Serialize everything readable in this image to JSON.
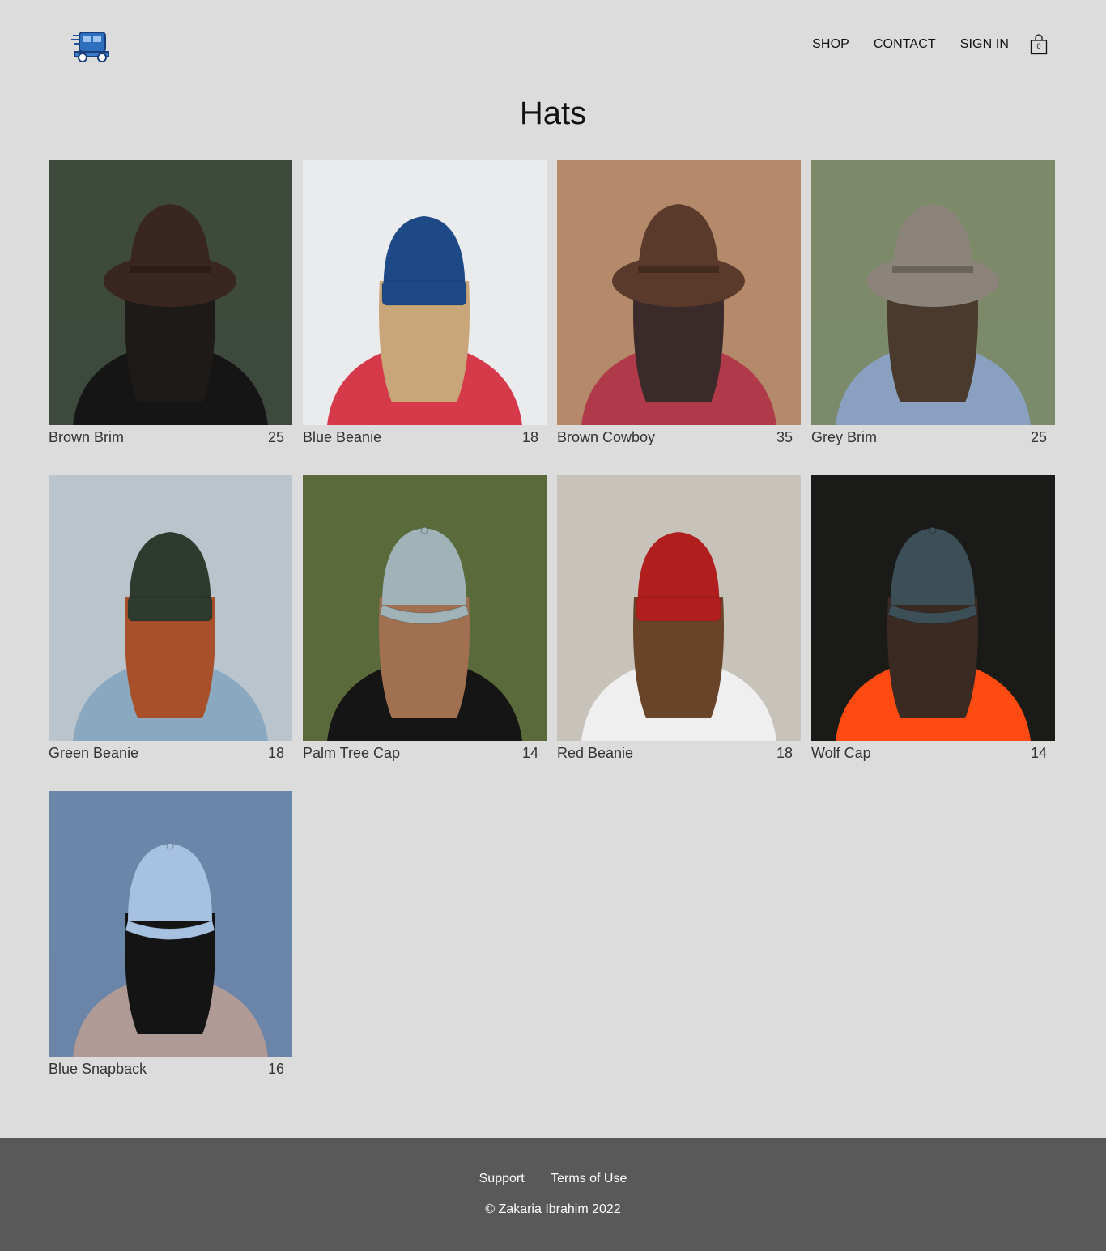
{
  "header": {
    "nav": [
      "SHOP",
      "CONTACT",
      "SIGN IN"
    ],
    "cart_count": "0"
  },
  "page_title": "Hats",
  "products": [
    {
      "name": "Brown Brim",
      "price": "25",
      "bg": "#3e4a3c",
      "hat": "#3a2620",
      "hair": "#1e1a18",
      "top": "#151515",
      "hatType": "brim"
    },
    {
      "name": "Blue Beanie",
      "price": "18",
      "bg": "#e9ebec",
      "hat": "#1d4a86",
      "hair": "#c9a67a",
      "top": "#d63a4a",
      "hatType": "beanie"
    },
    {
      "name": "Brown Cowboy",
      "price": "35",
      "bg": "#b58a6a",
      "hat": "#5a3a2a",
      "hair": "#3a2a2a",
      "top": "#b03a4a",
      "hatType": "brim"
    },
    {
      "name": "Grey Brim",
      "price": "25",
      "bg": "#7c8a6a",
      "hat": "#8c847a",
      "hair": "#4a3a2e",
      "top": "#8aa0c0",
      "hatType": "brim"
    },
    {
      "name": "Green Beanie",
      "price": "18",
      "bg": "#b9c4cc",
      "hat": "#2e3a2e",
      "hair": "#a8502a",
      "top": "#8aa8c0",
      "hatType": "beanie"
    },
    {
      "name": "Palm Tree Cap",
      "price": "14",
      "bg": "#5a6a3a",
      "hat": "#9fb3b8",
      "hair": "#a07050",
      "top": "#151515",
      "hatType": "cap"
    },
    {
      "name": "Red Beanie",
      "price": "18",
      "bg": "#c7c2ba",
      "hat": "#b01e1e",
      "hair": "#6a4428",
      "top": "#efefef",
      "hatType": "beanie"
    },
    {
      "name": "Wolf Cap",
      "price": "14",
      "bg": "#1a1a18",
      "hat": "#3c4e56",
      "hair": "#3a2a22",
      "top": "#ff4a12",
      "hatType": "cap"
    },
    {
      "name": "Blue Snapback",
      "price": "16",
      "bg": "#6a86a8",
      "hat": "#a6c2e0",
      "hair": "#141414",
      "top": "#b09a96",
      "hatType": "cap"
    }
  ],
  "footer": {
    "links": [
      "Support",
      "Terms of Use"
    ],
    "copyright": "© Zakaria Ibrahim 2022"
  }
}
